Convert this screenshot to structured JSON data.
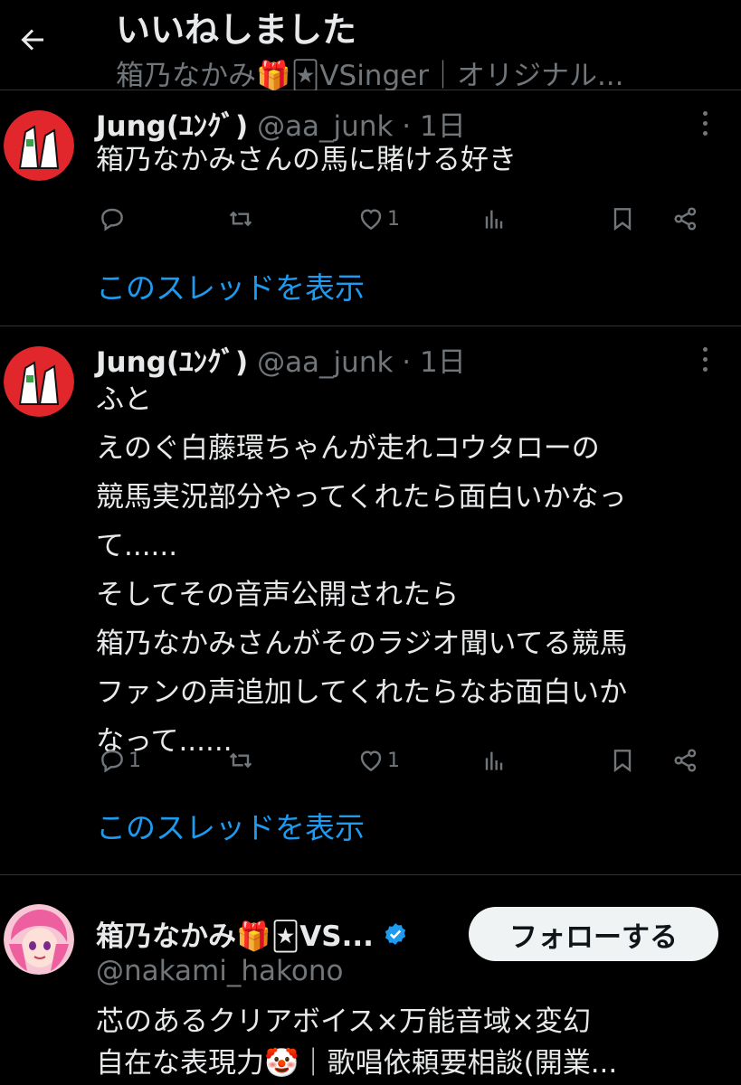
{
  "header": {
    "back_icon": "arrow-left-icon",
    "title": "いいねしました",
    "subtitle": "箱乃なかみ🎁🃏VSinger｜オリジナル..."
  },
  "tweets": [
    {
      "name": "Jung(ﾕﾝｸﾞ)",
      "handle": "@aa_junk",
      "time": "1日",
      "text": "箱乃なかみさんの馬に賭ける好き",
      "reply_count": "",
      "retweet_count": "",
      "like_count": "1",
      "show_thread": "このスレッドを表示"
    },
    {
      "name": "Jung(ﾕﾝｸﾞ)",
      "handle": "@aa_junk",
      "time": "1日",
      "text": "ふと\nえのぐ白藤環ちゃんが走れコウタローの\n競馬実況部分やってくれたら面白いかなっ\nて......\nそしてその音声公開されたら\n箱乃なかみさんがそのラジオ聞いてる競馬\nファンの声追加してくれたらなお面白いか\nなって......",
      "reply_count": "1",
      "retweet_count": "",
      "like_count": "1",
      "show_thread": "このスレッドを表示"
    }
  ],
  "user_card": {
    "name": "箱乃なかみ🎁🃏VS...",
    "handle": "@nakami_hakono",
    "follow_label": "フォローする",
    "bio": "芯のあるクリアボイス×万能音域×変幻\n自在な表現力🤡｜歌唱依頼要相談(開業..."
  },
  "colors": {
    "background": "#000000",
    "text": "#e7e9ea",
    "muted": "#71767b",
    "link": "#1d9bf0",
    "divider": "#2f3336"
  }
}
